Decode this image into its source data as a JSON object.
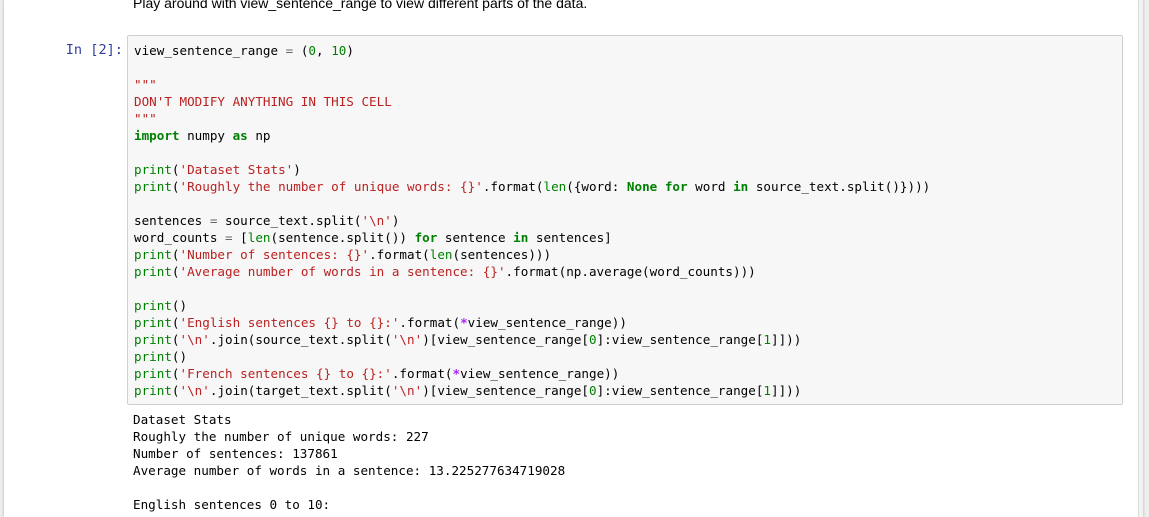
{
  "markdown_cell": {
    "text": "Play around with view_sentence_range to view different parts of the data."
  },
  "code_cell": {
    "prompt": "In [2]:",
    "lines": [
      "view_sentence_range = (0, 10)",
      "",
      "\"\"\"",
      "DON'T MODIFY ANYTHING IN THIS CELL",
      "\"\"\"",
      "import numpy as np",
      "",
      "print('Dataset Stats')",
      "print('Roughly the number of unique words: {}'.format(len({word: None for word in source_text.split()})))",
      "",
      "sentences = source_text.split('\\n')",
      "word_counts = [len(sentence.split()) for sentence in sentences]",
      "print('Number of sentences: {}'.format(len(sentences)))",
      "print('Average number of words in a sentence: {}'.format(np.average(word_counts)))",
      "",
      "print()",
      "print('English sentences {} to {}:'.format(*view_sentence_range))",
      "print('\\n'.join(source_text.split('\\n')[view_sentence_range[0]:view_sentence_range[1]]))",
      "print()",
      "print('French sentences {} to {}:'.format(*view_sentence_range))",
      "print('\\n'.join(target_text.split('\\n')[view_sentence_range[0]:view_sentence_range[1]]))"
    ]
  },
  "output": {
    "lines": [
      "Dataset Stats",
      "Roughly the number of unique words: 227",
      "Number of sentences: 137861",
      "Average number of words in a sentence: 13.225277634719028",
      "",
      "English sentences 0 to 10:"
    ]
  },
  "colors": {
    "prompt": "#303f9f",
    "keyword": "#008000",
    "string": "#ba2121",
    "input_background": "#f7f7f7",
    "input_border": "#cfcfcf"
  }
}
